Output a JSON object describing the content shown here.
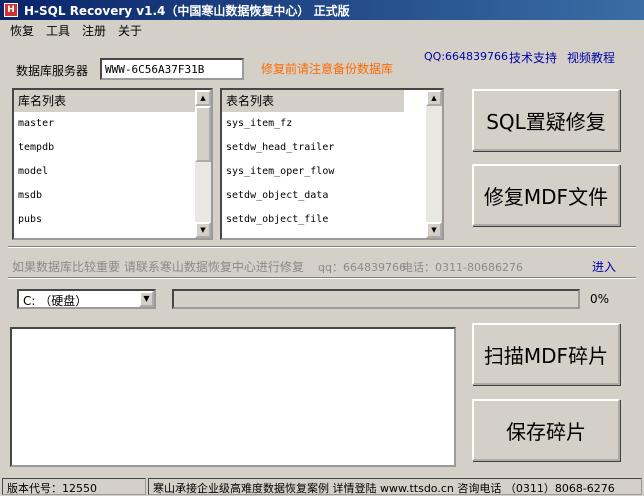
{
  "window": {
    "title": "H-SQL Recovery v1.4（中国寒山数据恢复中心） 正式版"
  },
  "menu": [
    "恢复",
    "工具",
    "注册",
    "关于"
  ],
  "server": {
    "label": "数据库服务器",
    "value": "WWW-6C56A37F31B",
    "warning": "修复前请注意备份数据库"
  },
  "links": {
    "qq": "QQ:664839766",
    "support": "技术支持",
    "video": "视频教程"
  },
  "db_list": {
    "header": "库名列表",
    "items": [
      "master",
      "tempdb",
      "model",
      "msdb",
      "pubs"
    ]
  },
  "table_list": {
    "header": "表名列表",
    "items": [
      "sys_item_fz",
      "setdw_head_trailer",
      "sys_item_oper_flow",
      "setdw_object_data",
      "setdw_object_file"
    ]
  },
  "buttons": {
    "sql_repair": "SQL置疑修复",
    "mdf_repair": "修复MDF文件",
    "scan_fragments": "扫描MDF碎片",
    "save_fragments": "保存碎片"
  },
  "notice": {
    "text": "如果数据库比较重要 请联系寒山数据恢复中心进行修复",
    "qq": "qq：664839766",
    "phone": "电话：0311-80686276",
    "enter": "进入"
  },
  "drive": {
    "selected": "C:  （硬盘）"
  },
  "progress": {
    "percent_label": "0%",
    "value": 0
  },
  "status": {
    "version": "版本代号：12550",
    "message": "寒山承接企业级高难度数据恢复案例 详情登陆 www.ttsdo.cn 咨询电话 （0311）8068-6276"
  }
}
